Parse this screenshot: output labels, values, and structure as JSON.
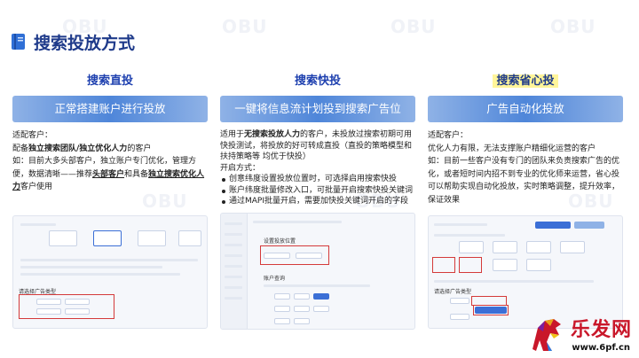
{
  "header": {
    "title": "搜索投放方式"
  },
  "columns": [
    {
      "title": "搜索直投",
      "banner": "正常搭建账户进行投放",
      "p1": "适配客户：",
      "p2a": "配备",
      "p2b": "独立搜索团队/独立优化人力",
      "p2c": "的客户",
      "p3a": "如：目前大多头部客户，独立账户专门优化，管理方便，数据清晰——推荐",
      "p3b": "头部客户",
      "p3c": "和具备",
      "p3d": "独立搜索优化人力",
      "p3e": "客户使用",
      "shot_label": "请选择广告类型"
    },
    {
      "title": "搜索快投",
      "banner": "一键将信息流计划投到搜索广告位",
      "p1a": "适用于",
      "p1b": "无搜索投放人力",
      "p1c": "的客户，未投放过搜索初期可用快投测试，将投放的好可转成直投（直投的策略模型和扶持策略等 均优于快投）",
      "p2": "开启方式：",
      "bullets": [
        "创意纬度设置投放位置时，可选择启用搜索快投",
        "账户纬度批量修改入口，可批量开启搜索快投关键词",
        "通过MAPI批量开启，需要加快投关键词开启的字段"
      ],
      "shot_label1": "设置投放位置",
      "shot_label2": "账户查询"
    },
    {
      "title": "搜索省心投",
      "banner": "广告自动化投放",
      "p1": "适配客户：",
      "p2": "优化人力有限，无法支撑账户精细化运营的客户",
      "p3": "如：目前一些客户没有专门的团队来负责搜索广告的优化，或者短时间内招不到专业的优化师来运营，省心投可以帮助实现自动化投放，实时策略调整，提升效率，保证效果",
      "shot_label": "请选择广告类型"
    }
  ],
  "logo": {
    "mark": "乐发网",
    "site": "www.6pf.cn"
  },
  "watermark": "OBU",
  "colors": {
    "title": "#1e3a8a",
    "banner": "#4f86d9",
    "highlight": "#fff59a",
    "accent_red": "#c9172a"
  }
}
